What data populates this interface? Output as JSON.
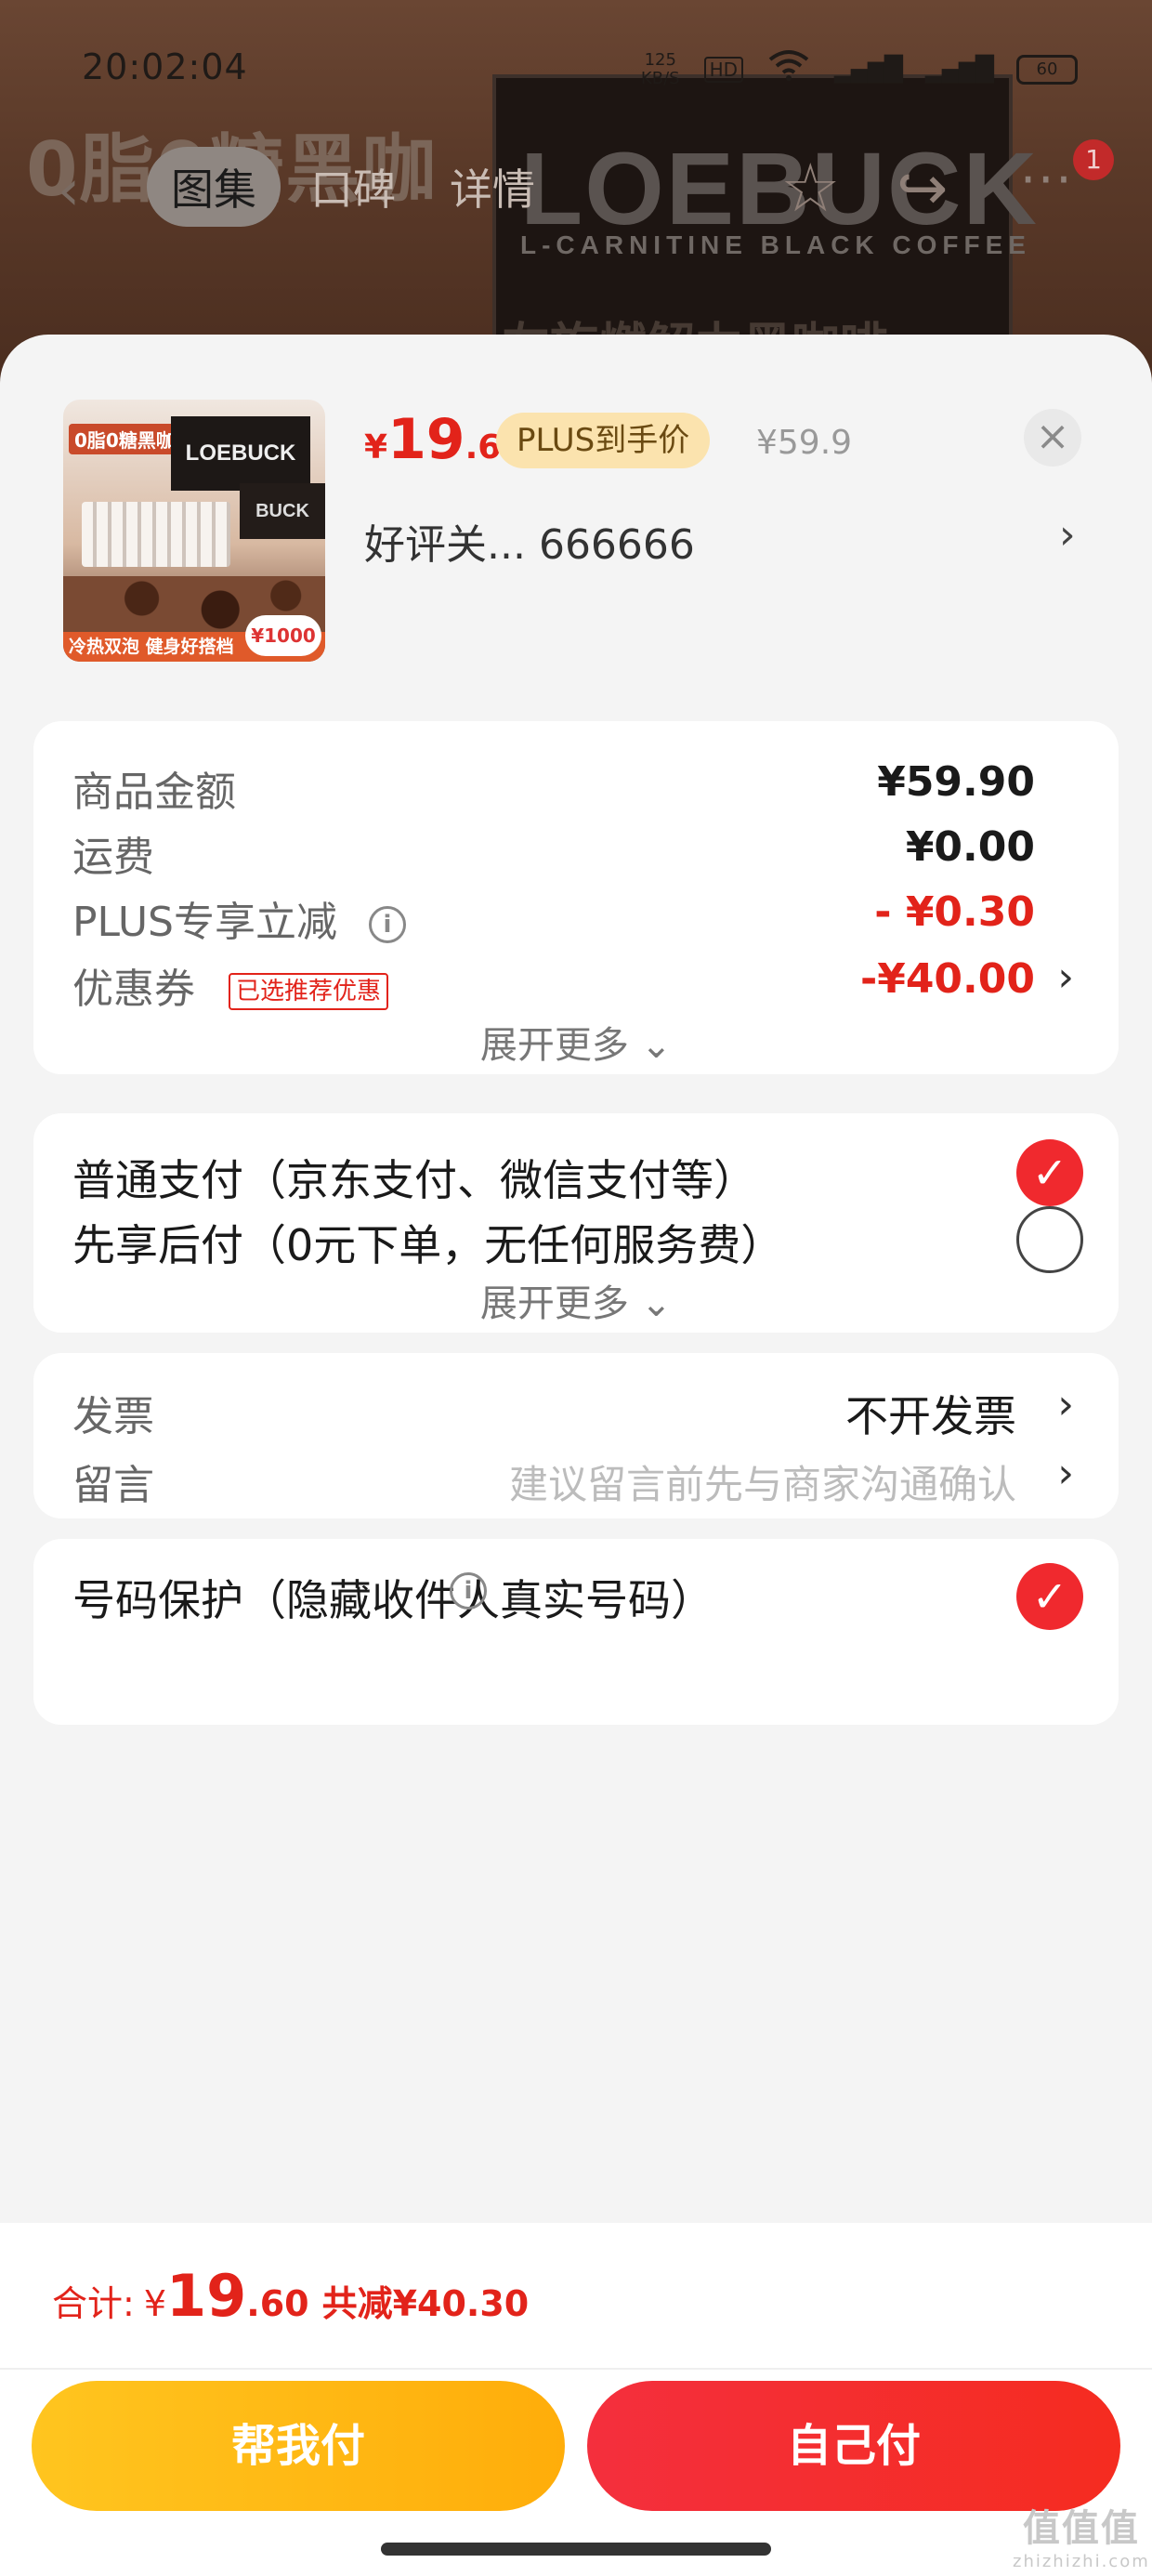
{
  "status_bar": {
    "time": "20:02:04",
    "net_speed": "125\nKB/S",
    "hd": "HD",
    "signal_1": "5G",
    "signal_2": "5G",
    "battery": "60"
  },
  "background": {
    "slogan": "0脂0糖黑咖",
    "brand": "LOEBUCK",
    "brand_sub": "L-CARNITINE BLACK COFFEE",
    "tagline": "左旋燃解力黑咖啡"
  },
  "nav": {
    "back_icon": "chevron-left-icon",
    "tabs": [
      {
        "label": "图集",
        "active": true
      },
      {
        "label": "口碑",
        "active": false
      },
      {
        "label": "详情",
        "active": false
      }
    ],
    "star_icon": "star-outline-icon",
    "share_icon": "share-icon",
    "more_icon": "more-dots-icon",
    "more_badge": "1"
  },
  "product": {
    "thumb": {
      "tag": "0脂0糖黑咖",
      "brand": "LOEBUCK",
      "brand_small": "BUCK",
      "bottom_text": "冷热双泡 健身好搭档",
      "badge": "¥1000"
    },
    "price_currency": "¥",
    "price_int": "19",
    "price_dec": ".6",
    "plus_tag": "PLUS到手价",
    "original_price": "¥59.9",
    "name": "好评关...  666666",
    "close_icon": "close-icon"
  },
  "summary": {
    "rows": [
      {
        "label": "商品金额",
        "value": "¥59.90"
      },
      {
        "label": "运费",
        "value": "¥0.00"
      },
      {
        "label": "PLUS专享立减",
        "value": "- ¥0.30"
      },
      {
        "label": "优惠券",
        "tag": "已选推荐优惠",
        "value": "-¥40.00"
      }
    ],
    "expand_label": "展开更多"
  },
  "payment": {
    "options": [
      {
        "label": "普通支付（京东支付、微信支付等）",
        "selected": true
      },
      {
        "label": "先享后付（0元下单，无任何服务费）",
        "selected": false
      }
    ],
    "expand_label": "展开更多"
  },
  "extras": {
    "invoice_label": "发票",
    "invoice_value": "不开发票",
    "note_label": "留言",
    "note_placeholder": "建议留言前先与商家沟通确认"
  },
  "privacy": {
    "label": "号码保护（隐藏收件人真实号码）",
    "checked": true
  },
  "footer": {
    "total_label": "合计:",
    "total_currency": "¥",
    "total_int": "19",
    "total_dec": ".60",
    "saved": "共减¥40.30",
    "help_pay": "帮我付",
    "self_pay": "自己付",
    "watermark": "值值值",
    "watermark_url": "zhizhizhi.com"
  },
  "colors": {
    "accent_red": "#e2231a",
    "plus_gold": "#fbe3ae",
    "help_btn": "#ffb814",
    "self_btn": "#f42f3d"
  }
}
